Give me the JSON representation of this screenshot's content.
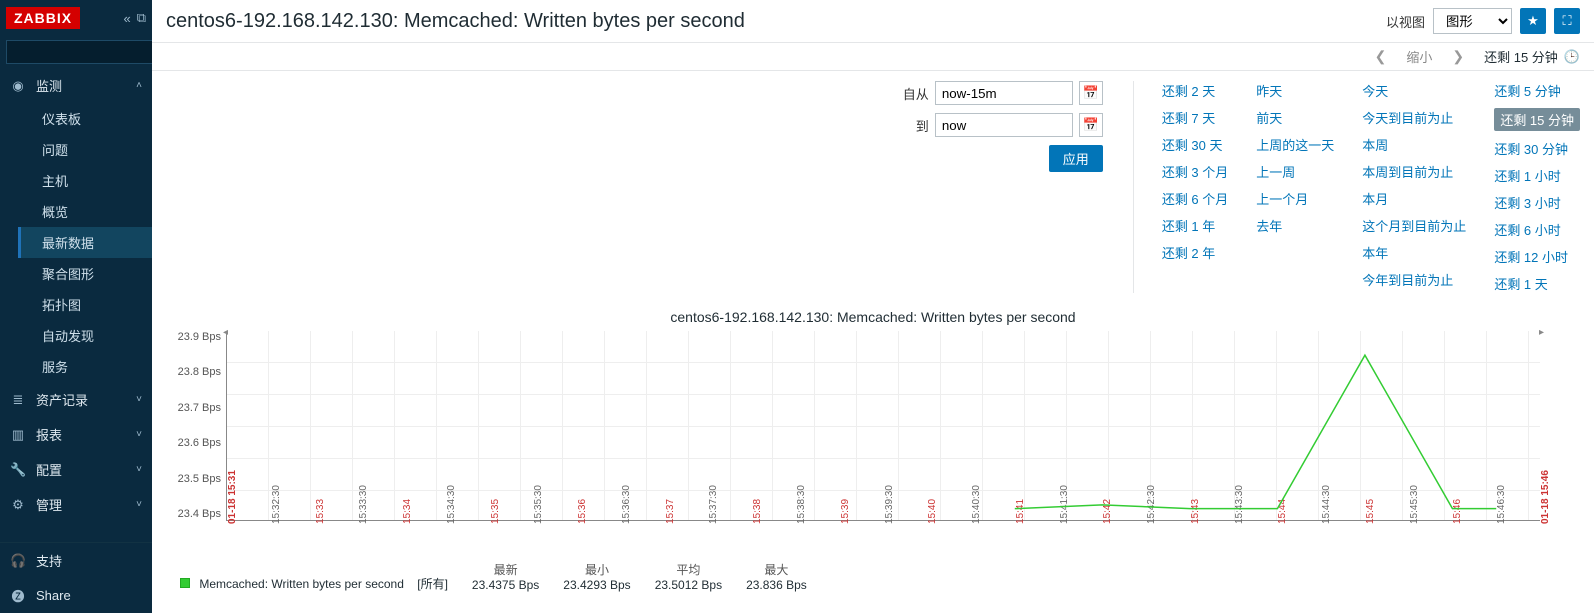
{
  "brand": "ZABBIX",
  "search_placeholder": "",
  "sidebar": {
    "sections": [
      {
        "icon": "eye",
        "label": "监测",
        "expanded": true,
        "items": [
          "仪表板",
          "问题",
          "主机",
          "概览",
          "最新数据",
          "聚合图形",
          "拓扑图",
          "自动发现",
          "服务"
        ],
        "active_item": "最新数据"
      },
      {
        "icon": "list",
        "label": "资产记录",
        "expanded": false
      },
      {
        "icon": "bar",
        "label": "报表",
        "expanded": false
      },
      {
        "icon": "wrench",
        "label": "配置",
        "expanded": false
      },
      {
        "icon": "gear",
        "label": "管理",
        "expanded": false
      }
    ],
    "footer": [
      {
        "icon": "headset",
        "label": "支持"
      },
      {
        "icon": "share",
        "label": "Share"
      }
    ]
  },
  "header": {
    "title": "centos6-192.168.142.130: Memcached: Written bytes per second",
    "view_label": "以视图",
    "view_select": "图形"
  },
  "timebar": {
    "zoom_out": "缩小",
    "current": "还剩 15 分钟"
  },
  "time_form": {
    "from_label": "自从",
    "from_value": "now-15m",
    "to_label": "到",
    "to_value": "now",
    "apply": "应用"
  },
  "presets": {
    "col1": [
      "还剩 2 天",
      "还剩 7 天",
      "还剩 30 天",
      "还剩 3 个月",
      "还剩 6 个月",
      "还剩 1 年",
      "还剩 2 年"
    ],
    "col2": [
      "昨天",
      "前天",
      "上周的这一天",
      "上一周",
      "上一个月",
      "去年"
    ],
    "col3": [
      "今天",
      "今天到目前为止",
      "本周",
      "本周到目前为止",
      "本月",
      "这个月到目前为止",
      "本年",
      "今年到目前为止"
    ],
    "col4": [
      "还剩 5 分钟",
      "还剩 15 分钟",
      "还剩 30 分钟",
      "还剩 1 小时",
      "还剩 3 小时",
      "还剩 6 小时",
      "还剩 12 小时",
      "还剩 1 天"
    ],
    "active": "还剩 15 分钟"
  },
  "chart_data": {
    "type": "line",
    "title": "centos6-192.168.142.130: Memcached: Written bytes per second",
    "ylabel": "Bps",
    "ylim": [
      23.4,
      23.9
    ],
    "y_ticks": [
      "23.9 Bps",
      "23.8 Bps",
      "23.7 Bps",
      "23.6 Bps",
      "23.5 Bps",
      "23.4 Bps"
    ],
    "x_start": "01-18 15:31",
    "x_end": "01-18 15:46",
    "x_ticks": [
      {
        "label": "01-18 15:31",
        "major": false,
        "bound": true
      },
      {
        "label": "15:32:30",
        "major": false
      },
      {
        "label": "15:33",
        "major": true
      },
      {
        "label": "15:33:30",
        "major": false
      },
      {
        "label": "15:34",
        "major": true
      },
      {
        "label": "15:34:30",
        "major": false
      },
      {
        "label": "15:35",
        "major": true
      },
      {
        "label": "15:35:30",
        "major": false
      },
      {
        "label": "15:36",
        "major": true
      },
      {
        "label": "15:36:30",
        "major": false
      },
      {
        "label": "15:37",
        "major": true
      },
      {
        "label": "15:37:30",
        "major": false
      },
      {
        "label": "15:38",
        "major": true
      },
      {
        "label": "15:38:30",
        "major": false
      },
      {
        "label": "15:39",
        "major": true
      },
      {
        "label": "15:39:30",
        "major": false
      },
      {
        "label": "15:40",
        "major": true
      },
      {
        "label": "15:40:30",
        "major": false
      },
      {
        "label": "15:41",
        "major": true
      },
      {
        "label": "15:41:30",
        "major": false
      },
      {
        "label": "15:42",
        "major": true
      },
      {
        "label": "15:42:30",
        "major": false
      },
      {
        "label": "15:43",
        "major": true
      },
      {
        "label": "15:43:30",
        "major": false
      },
      {
        "label": "15:44",
        "major": true
      },
      {
        "label": "15:44:30",
        "major": false
      },
      {
        "label": "15:45",
        "major": true
      },
      {
        "label": "15:45:30",
        "major": false
      },
      {
        "label": "15:46",
        "major": true
      },
      {
        "label": "15:46:30",
        "major": false
      },
      {
        "label": "01-18 15:46",
        "major": false,
        "bound": true
      }
    ],
    "series": [
      {
        "name": "Memcached: Written bytes per second",
        "color": "#33cc33",
        "points": [
          {
            "x": "15:41",
            "y": 23.43
          },
          {
            "x": "15:42",
            "y": 23.44
          },
          {
            "x": "15:43",
            "y": 23.43
          },
          {
            "x": "15:44",
            "y": 23.43
          },
          {
            "x": "15:45",
            "y": 23.836
          },
          {
            "x": "15:46",
            "y": 23.43
          },
          {
            "x": "15:46:30",
            "y": 23.43
          }
        ]
      }
    ]
  },
  "legend": {
    "series_name": "Memcached: Written bytes per second",
    "scope": "[所有]",
    "cols": [
      {
        "hdr": "最新",
        "val": "23.4375 Bps"
      },
      {
        "hdr": "最小",
        "val": "23.4293 Bps"
      },
      {
        "hdr": "平均",
        "val": "23.5012 Bps"
      },
      {
        "hdr": "最大",
        "val": "23.836 Bps"
      }
    ]
  }
}
